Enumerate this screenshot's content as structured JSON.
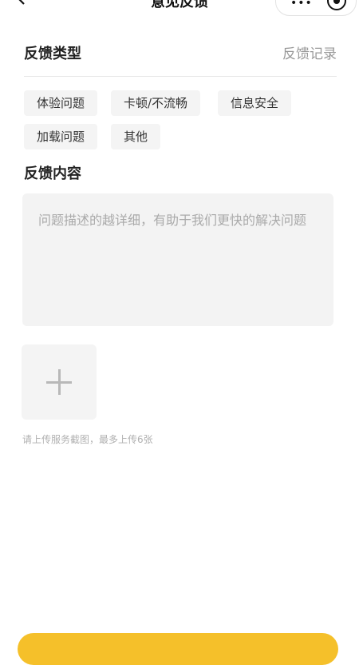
{
  "nav": {
    "title": "意见反馈",
    "more_icon": "more-dots-icon",
    "close_icon": "target-icon"
  },
  "feedback_type": {
    "label": "反馈类型",
    "record_link": "反馈记录",
    "options": [
      "体验问题",
      "卡顿/不流畅",
      "信息安全",
      "加载问题",
      "其他"
    ]
  },
  "feedback_content": {
    "label": "反馈内容",
    "placeholder": "问题描述的越详细，有助于我们更快的解决问题"
  },
  "upload": {
    "icon": "plus-icon",
    "hint": "请上传服务截图，最多上传6张"
  },
  "colors": {
    "accent": "#f5c02a",
    "chip_bg": "#f4f4f4",
    "input_bg": "#f3f3f3"
  }
}
